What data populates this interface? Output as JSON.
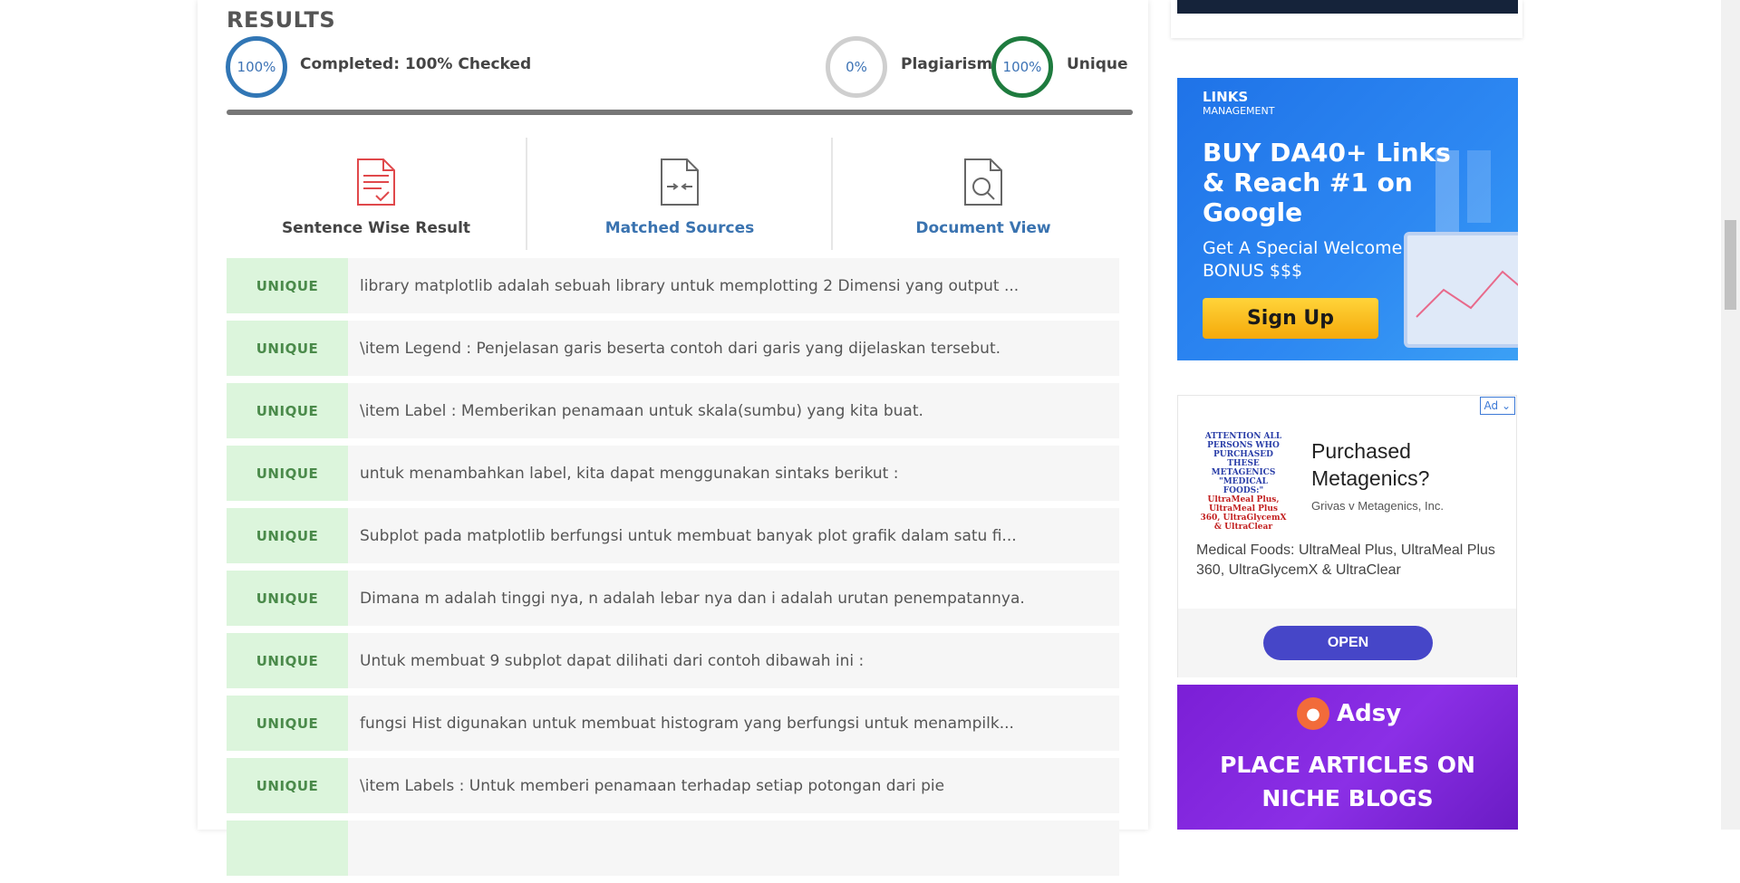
{
  "results": {
    "title": "RESULTS",
    "completed_percent": "100%",
    "completed_label": "Completed: 100% Checked",
    "plagiarism_percent": "0%",
    "plagiarism_label": "Plagiarism",
    "unique_percent": "100%",
    "unique_label": "Unique",
    "progress_fraction": 1.0
  },
  "tabs": [
    {
      "label": "Sentence Wise Result",
      "icon": "document-check-icon"
    },
    {
      "label": "Matched Sources",
      "icon": "document-compare-icon"
    },
    {
      "label": "Document View",
      "icon": "document-search-icon"
    }
  ],
  "rows": [
    {
      "badge": "UNIQUE",
      "text": "library matplotlib adalah sebuah library untuk memplotting 2 Dimensi yang output ..."
    },
    {
      "badge": "UNIQUE",
      "text": "\\item Legend : Penjelasan garis beserta contoh dari garis yang dijelaskan tersebut."
    },
    {
      "badge": "UNIQUE",
      "text": "\\item Label : Memberikan penamaan untuk skala(sumbu) yang kita buat."
    },
    {
      "badge": "UNIQUE",
      "text": "untuk menambahkan label, kita dapat menggunakan sintaks berikut :"
    },
    {
      "badge": "UNIQUE",
      "text": "Subplot pada matplotlib berfungsi untuk membuat banyak plot grafik dalam satu fi..."
    },
    {
      "badge": "UNIQUE",
      "text": "Dimana m adalah tinggi nya, n adalah lebar nya dan i adalah urutan penempatannya."
    },
    {
      "badge": "UNIQUE",
      "text": "Untuk membuat 9 subplot dapat dilihati dari contoh dibawah ini :"
    },
    {
      "badge": "UNIQUE",
      "text": "fungsi Hist digunakan untuk membuat histogram yang berfungsi untuk menampilk..."
    },
    {
      "badge": "UNIQUE",
      "text": "\\item Labels : Untuk memberi penamaan terhadap setiap potongan dari pie"
    }
  ],
  "ads": {
    "links_management": {
      "brand": "LINKS",
      "brand_sub": "MANAGEMENT",
      "headline": "BUY DA40+ Links & Reach #1 on Google",
      "sub": "Get A Special Welcome BONUS $$$",
      "cta": "Sign Up"
    },
    "metagenics": {
      "badge": "Ad",
      "flyer_blue": "ATTENTION ALL PERSONS WHO PURCHASED THESE METAGENICS \"MEDICAL FOODS:\"",
      "flyer_red": "UltraMeal Plus, UltraMeal Plus 360, UltraGlycemX & UltraClear",
      "title": "Purchased Metagenics?",
      "advertiser": "Grivas v Metagenics, Inc.",
      "description": "Medical Foods: UltraMeal Plus, UltraMeal Plus 360, UltraGlycemX & UltraClear",
      "cta": "OPEN"
    },
    "adsy": {
      "brand": "Adsy",
      "headline": "PLACE ARTICLES ON NICHE BLOGS"
    }
  },
  "colors": {
    "accent_blue": "#3176b5",
    "unique_green": "#1e7b3e",
    "badge_bg": "#dcf5dc"
  }
}
